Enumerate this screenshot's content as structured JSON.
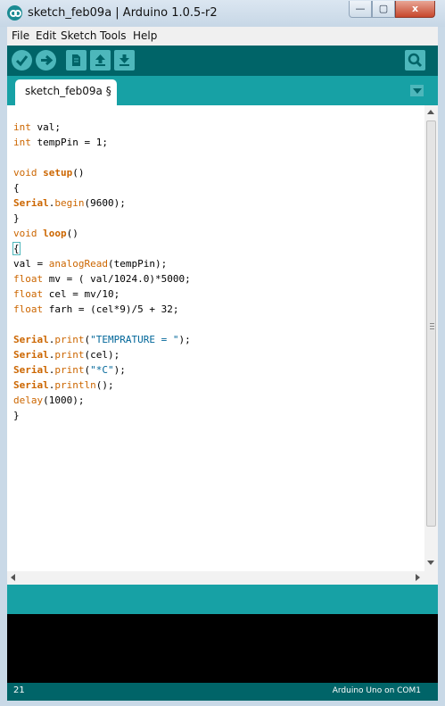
{
  "window": {
    "title": "sketch_feb09a | Arduino 1.0.5-r2"
  },
  "controls": {
    "minimize": "—",
    "maximize": "▢",
    "close": "x"
  },
  "menu": [
    "File",
    "Edit",
    "Sketch",
    "Tools",
    "Help"
  ],
  "toolbar": {
    "buttons": [
      "verify-icon",
      "upload-icon",
      "new-icon",
      "open-icon",
      "save-icon"
    ],
    "serial_monitor": "serial-monitor-icon"
  },
  "tabs": [
    {
      "label": "sketch_feb09a §"
    }
  ],
  "editor": {
    "code": [
      "int val;",
      "int tempPin = 1;",
      "",
      "void setup()",
      "{",
      "Serial.begin(9600);",
      "}",
      "void loop()",
      "{",
      "val = analogRead(tempPin);",
      "float mv = ( val/1024.0)*5000;",
      "float cel = mv/10;",
      "float farh = (cel*9)/5 + 32;",
      "",
      "Serial.print(\"TEMPRATURE = \");",
      "Serial.print(cel);",
      "Serial.print(\"*C\");",
      "Serial.println();",
      "delay(1000);",
      "}"
    ]
  },
  "status": {
    "line": "21",
    "board": "Arduino Uno on COM1"
  },
  "colors": {
    "teal_dark": "#006468",
    "teal": "#17a1a5",
    "keyword": "#cc6600",
    "string": "#006699"
  }
}
